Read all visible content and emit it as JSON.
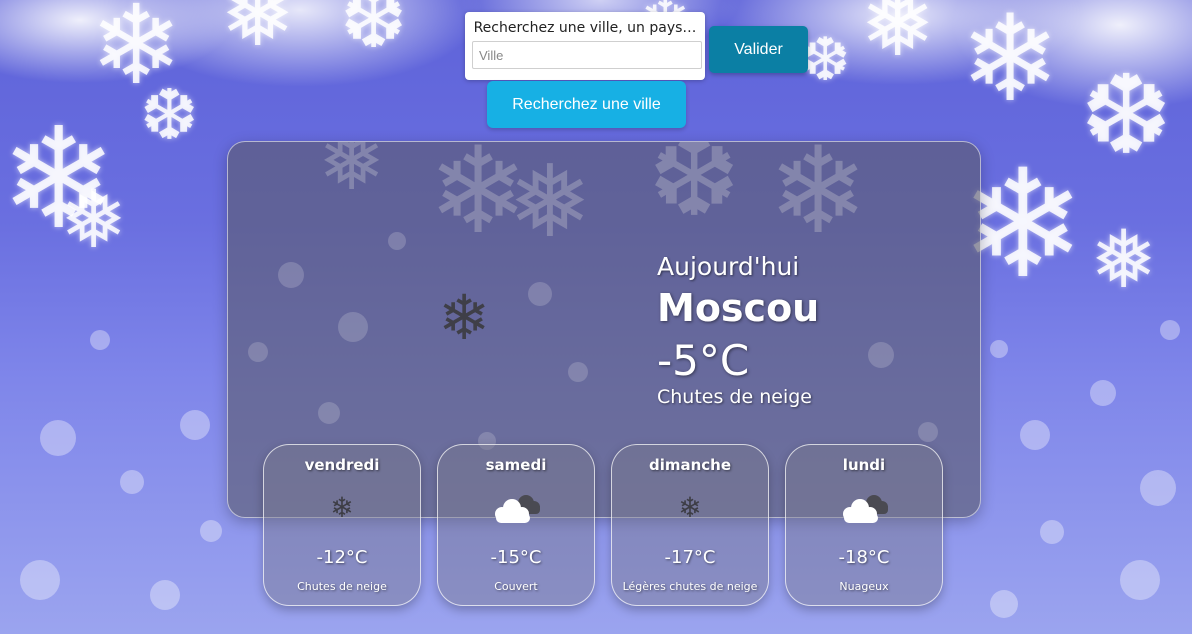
{
  "search": {
    "label": "Recherchez une ville, un pays…",
    "placeholder": "Ville",
    "value": "",
    "validate_label": "Valider",
    "search_city_label": "Recherchez une ville"
  },
  "current": {
    "day_label": "Aujourd'hui",
    "city": "Moscou",
    "temperature": "-5°C",
    "condition": "Chutes de neige",
    "icon": "snowflake-icon"
  },
  "forecast": [
    {
      "day": "vendredi",
      "temperature": "-12°C",
      "description": "Chutes de neige",
      "icon": "snowflake-icon"
    },
    {
      "day": "samedi",
      "temperature": "-15°C",
      "description": "Couvert",
      "icon": "cloud-icon"
    },
    {
      "day": "dimanche",
      "temperature": "-17°C",
      "description": "Légères chutes de neige",
      "icon": "snowflake-icon"
    },
    {
      "day": "lundi",
      "temperature": "-18°C",
      "description": "Nuageux",
      "icon": "cloud-icon"
    }
  ],
  "colors": {
    "validate_button": "#0b7fa4",
    "search_city_button": "#17b0e4",
    "background": "#6a6fe0"
  }
}
